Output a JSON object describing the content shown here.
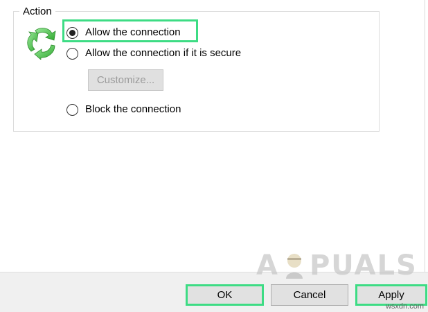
{
  "group": {
    "title": "Action"
  },
  "radios": [
    {
      "label": "Allow the connection",
      "checked": true
    },
    {
      "label": "Allow the connection if it is secure",
      "checked": false
    },
    {
      "label": "Block the connection",
      "checked": false
    }
  ],
  "buttons": {
    "customize": "Customize...",
    "ok": "OK",
    "cancel": "Cancel",
    "apply": "Apply"
  },
  "watermark": {
    "left": "A",
    "right": "PUALS"
  },
  "site_tag": "wsxdn.com",
  "icons": {
    "action": "green-recycle-arrows-icon",
    "mascot": "appuals-mascot-icon"
  },
  "colors": {
    "highlight": "#3ddc84",
    "icon_green": "#4cc74c"
  }
}
